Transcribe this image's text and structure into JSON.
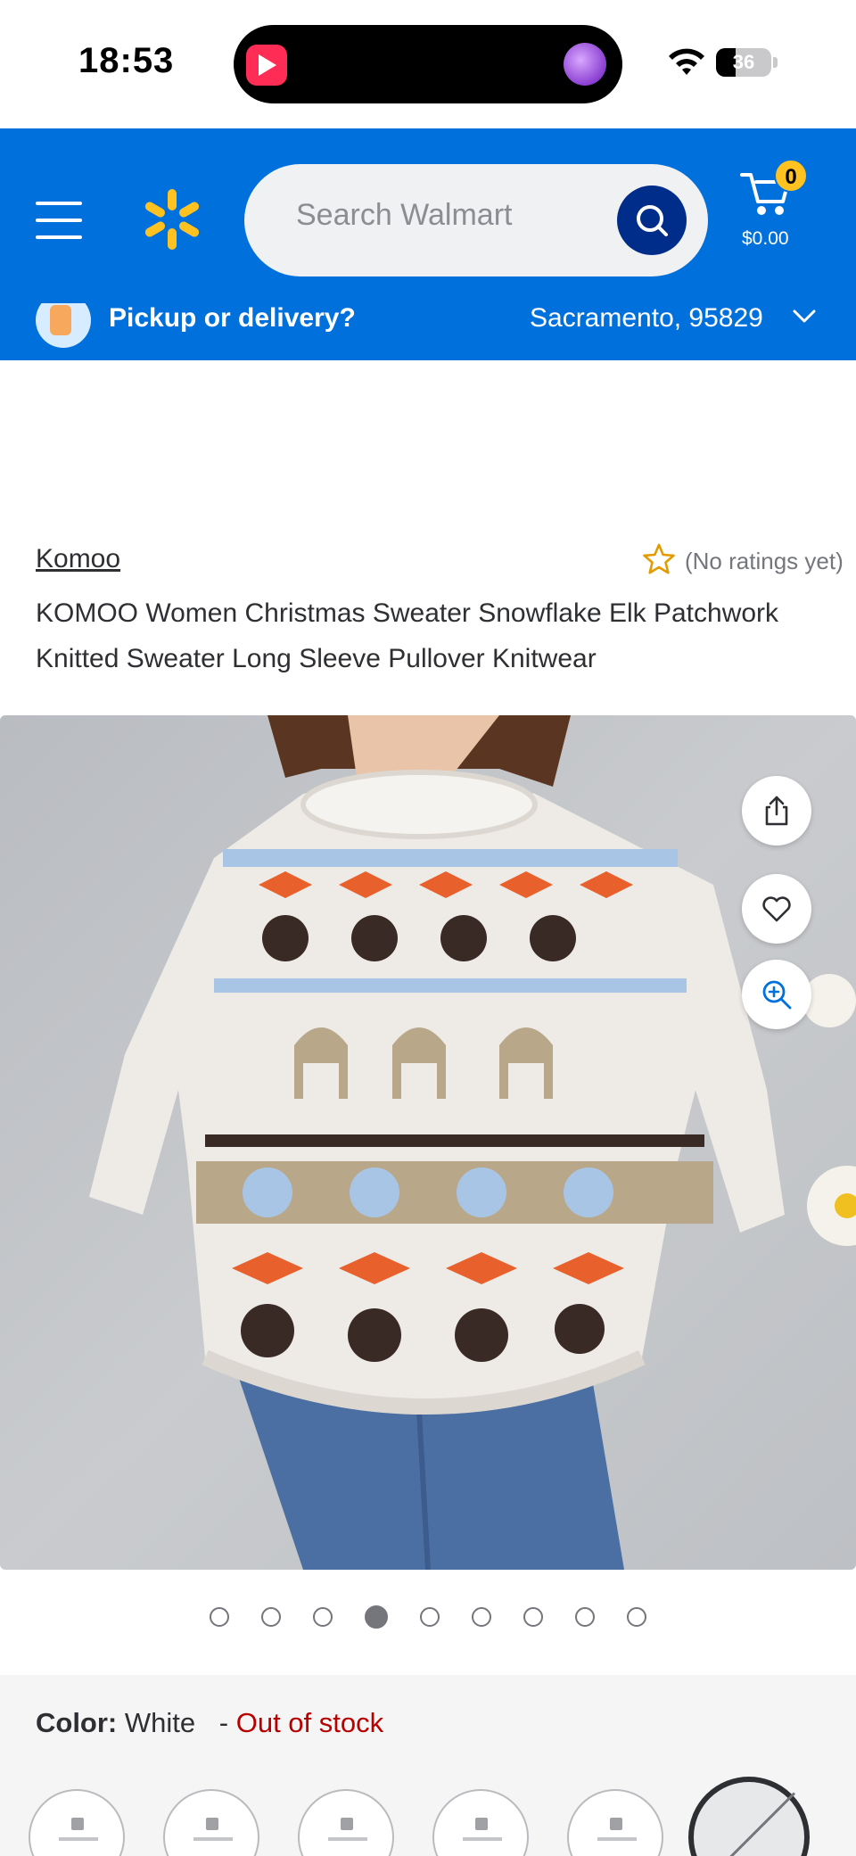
{
  "status_bar": {
    "time": "18:53",
    "battery": "36",
    "battery_level": 0.36,
    "icons": [
      "wifi-icon",
      "battery-icon"
    ]
  },
  "header": {
    "search_placeholder": "Search Walmart",
    "cart_count": "0",
    "cart_total": "$0.00",
    "pickup_label": "Pickup or delivery?",
    "location": "Sacramento, 95829",
    "brand_color": "#0071dc",
    "accent_color": "#ffc220"
  },
  "product": {
    "brand": "Komoo",
    "rating_text": "(No ratings yet)",
    "title": "KOMOO Women Christmas Sweater Snowflake Elk Patchwork Knitted Sweater Long Sleeve Pullover Knitwear"
  },
  "carousel": {
    "total": 9,
    "active_index": 3
  },
  "color": {
    "key": "Color:",
    "value": "White",
    "separator": "-",
    "stock": "Out of stock",
    "stock_color": "#b80000"
  }
}
